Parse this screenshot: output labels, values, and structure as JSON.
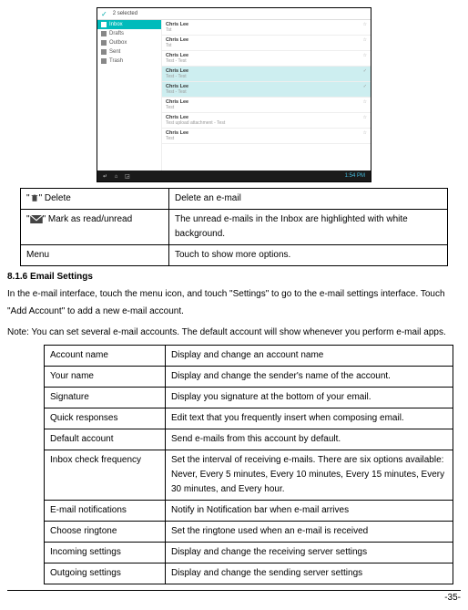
{
  "screenshot": {
    "topbar_selected": "2 selected",
    "side": {
      "inbox": "Inbox",
      "drafts": "Drafts",
      "outbox": "Outbox",
      "sent": "Sent",
      "trash": "Trash"
    },
    "rows": [
      {
        "name": "Chris Lee",
        "sub": "Tst",
        "sel": false
      },
      {
        "name": "Chris Lee",
        "sub": "Tst",
        "sel": false
      },
      {
        "name": "Chris Lee",
        "sub": "Test - Test",
        "sel": false
      },
      {
        "name": "Chris Lee",
        "sub": "Test - Test",
        "sel": true
      },
      {
        "name": "Chris Lee",
        "sub": "Test - Test",
        "sel": true
      },
      {
        "name": "Chris Lee",
        "sub": "Test",
        "sel": false
      },
      {
        "name": "Chris Lee",
        "sub": "Test upload attachment - Test",
        "sel": false
      },
      {
        "name": "Chris Lee",
        "sub": "Test",
        "sel": false
      }
    ],
    "time": "1:54 PM"
  },
  "table1": {
    "r1": {
      "a_suffix": "\" Delete",
      "b": "Delete an e-mail"
    },
    "r2": {
      "a_suffix": "\" Mark as read/unread",
      "b": "The unread e-mails in the Inbox are highlighted with white background."
    },
    "r3": {
      "a": "Menu",
      "b": "Touch to show more options."
    }
  },
  "heading": "8.1.6 Email Settings",
  "para1": "In the e-mail interface, touch the menu icon, and touch \"Settings\" to go to the e-mail settings interface. Touch \"Add Account\" to add a new e-mail account.",
  "para2": "Note: You can set several e-mail accounts. The default account will show whenever you perform e-mail apps.",
  "table2": [
    {
      "a": "Account name",
      "b": "Display and change an account name"
    },
    {
      "a": "Your name",
      "b": "Display and change the sender's name of the account."
    },
    {
      "a": "Signature",
      "b": "Display you signature at the bottom of your email."
    },
    {
      "a": "Quick responses",
      "b": "Edit text that you frequently insert when composing email."
    },
    {
      "a": "Default account",
      "b": "Send e-mails from this account by default."
    },
    {
      "a": "Inbox check frequency",
      "b": "Set the interval of receiving e-mails. There are six options available: Never, Every 5 minutes, Every 10 minutes, Every 15 minutes, Every 30 minutes, and Every hour."
    },
    {
      "a": "E-mail notifications",
      "b": "Notify in Notification bar when e-mail arrives"
    },
    {
      "a": "Choose ringtone",
      "b": "Set the ringtone used when an e-mail is received"
    },
    {
      "a": "Incoming settings",
      "b": "Display and change the receiving server settings"
    },
    {
      "a": "Outgoing settings",
      "b": "Display and change the sending server settings"
    }
  ],
  "page_number": "-35-",
  "quote": "\""
}
